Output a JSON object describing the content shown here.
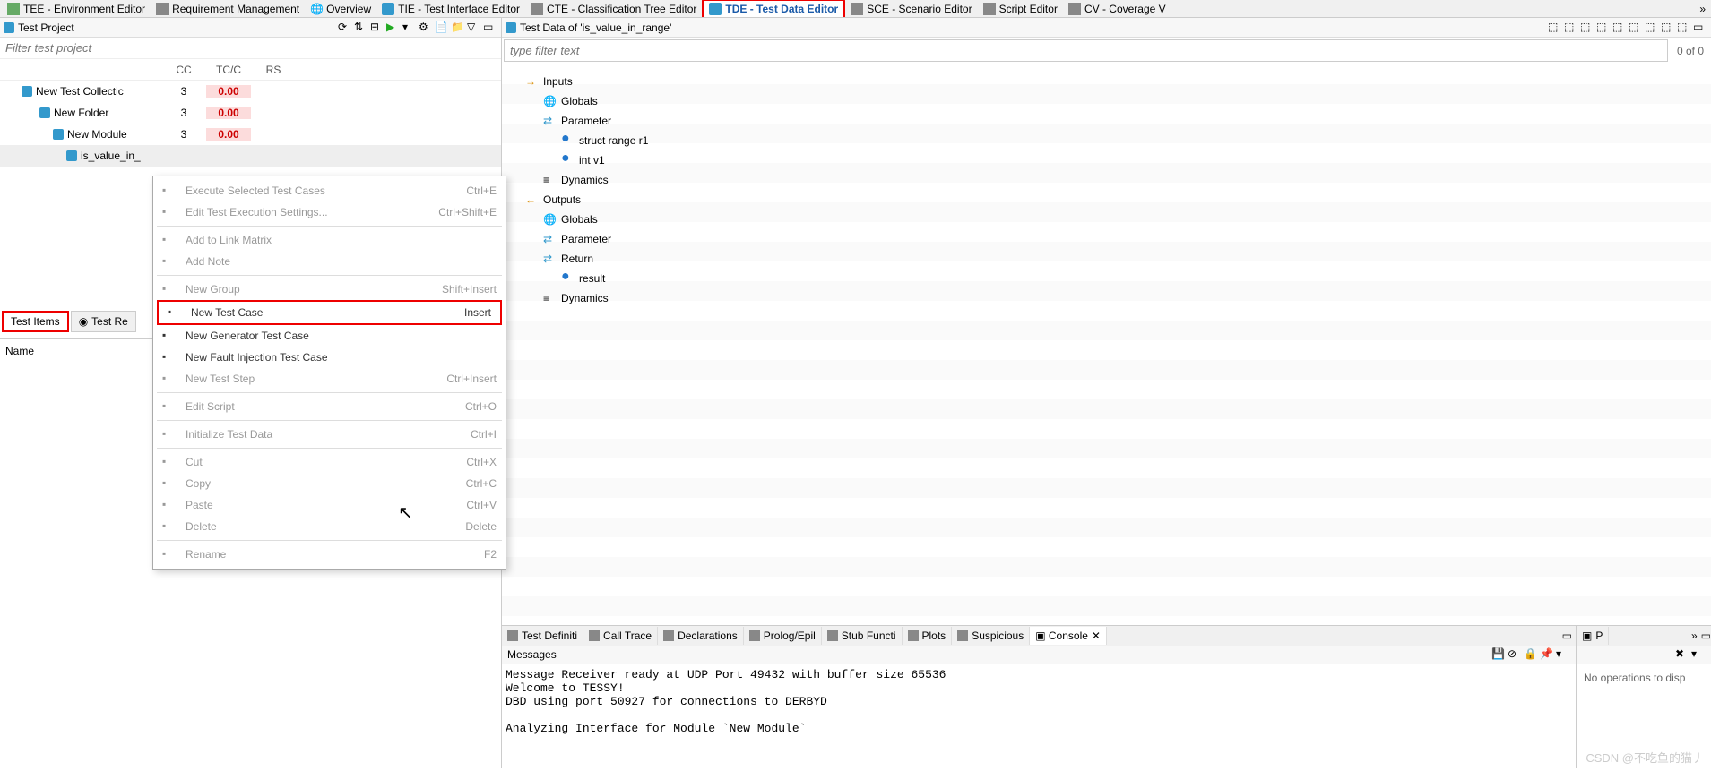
{
  "top_tabs": [
    {
      "label": "TEE - Environment Editor"
    },
    {
      "label": "Requirement Management"
    },
    {
      "label": "Overview"
    },
    {
      "label": "TIE - Test Interface Editor"
    },
    {
      "label": "CTE - Classification Tree Editor"
    },
    {
      "label": "TDE - Test Data Editor"
    },
    {
      "label": "SCE - Scenario Editor"
    },
    {
      "label": "Script Editor"
    },
    {
      "label": "CV - Coverage V"
    }
  ],
  "left": {
    "title": "Test Project",
    "filter_placeholder": "Filter test project",
    "cols": [
      "CC",
      "TC/C",
      "RS"
    ],
    "rows": [
      {
        "label": "New Test Collectic",
        "cc": "3",
        "tc": "0.00",
        "indent": 20
      },
      {
        "label": "New Folder",
        "cc": "3",
        "tc": "0.00",
        "indent": 40
      },
      {
        "label": "New Module",
        "cc": "3",
        "tc": "0.00",
        "indent": 55
      },
      {
        "label": "is_value_in_",
        "cc": "",
        "tc": "",
        "indent": 70
      }
    ],
    "bottom_tabs": [
      "Test Items",
      "Test Re"
    ],
    "name_col": "Name"
  },
  "context_menu": {
    "items": [
      {
        "label": "Execute Selected Test Cases",
        "shortcut": "Ctrl+E",
        "enabled": false
      },
      {
        "label": "Edit Test Execution Settings...",
        "shortcut": "Ctrl+Shift+E",
        "enabled": false
      },
      {
        "sep": true
      },
      {
        "label": "Add to Link Matrix",
        "shortcut": "",
        "enabled": false
      },
      {
        "label": "Add Note",
        "shortcut": "",
        "enabled": false
      },
      {
        "sep": true
      },
      {
        "label": "New Group",
        "shortcut": "Shift+Insert",
        "enabled": false
      },
      {
        "label": "New Test Case",
        "shortcut": "Insert",
        "enabled": true,
        "highlighted": true
      },
      {
        "label": "New Generator Test Case",
        "shortcut": "",
        "enabled": true
      },
      {
        "label": "New Fault Injection Test Case",
        "shortcut": "",
        "enabled": true
      },
      {
        "label": "New Test Step",
        "shortcut": "Ctrl+Insert",
        "enabled": false
      },
      {
        "sep": true
      },
      {
        "label": "Edit Script",
        "shortcut": "Ctrl+O",
        "enabled": false
      },
      {
        "sep": true
      },
      {
        "label": "Initialize Test Data",
        "shortcut": "Ctrl+I",
        "enabled": false
      },
      {
        "sep": true
      },
      {
        "label": "Cut",
        "shortcut": "Ctrl+X",
        "enabled": false
      },
      {
        "label": "Copy",
        "shortcut": "Ctrl+C",
        "enabled": false
      },
      {
        "label": "Paste",
        "shortcut": "Ctrl+V",
        "enabled": false
      },
      {
        "label": "Delete",
        "shortcut": "Delete",
        "enabled": false
      },
      {
        "sep": true
      },
      {
        "label": "Rename",
        "shortcut": "F2",
        "enabled": false
      }
    ]
  },
  "right": {
    "title": "Test Data of 'is_value_in_range'",
    "filter_placeholder": "type filter text",
    "count": "0 of 0",
    "tree": [
      {
        "label": "Inputs",
        "indent": 0,
        "icon": "arrow-in"
      },
      {
        "label": "Globals",
        "indent": 20,
        "icon": "globe"
      },
      {
        "label": "Parameter",
        "indent": 20,
        "icon": "param"
      },
      {
        "label": "struct range r1",
        "indent": 40,
        "icon": "dot"
      },
      {
        "label": "int v1",
        "indent": 40,
        "icon": "dot"
      },
      {
        "label": "Dynamics",
        "indent": 20,
        "icon": "list"
      },
      {
        "label": "Outputs",
        "indent": 0,
        "icon": "arrow-out"
      },
      {
        "label": "Globals",
        "indent": 20,
        "icon": "globe"
      },
      {
        "label": "Parameter",
        "indent": 20,
        "icon": "param"
      },
      {
        "label": "Return",
        "indent": 20,
        "icon": "param"
      },
      {
        "label": "result",
        "indent": 40,
        "icon": "dot"
      },
      {
        "label": "Dynamics",
        "indent": 20,
        "icon": "list"
      }
    ]
  },
  "bottom": {
    "tabs": [
      "Test Definiti",
      "Call Trace",
      "Declarations",
      "Prolog/Epil",
      "Stub Functi",
      "Plots",
      "Suspicious"
    ],
    "console_tab": "Console",
    "messages_label": "Messages",
    "console_text": "Message Receiver ready at UDP Port 49432 with buffer size 65536\nWelcome to TESSY!\nDBD using port 50927 for connections to DERBYD\n\nAnalyzing Interface for Module `New Module`",
    "p_tab": "P",
    "no_ops": "No operations to disp"
  },
  "watermark": "CSDN @不吃鱼的猫丿"
}
